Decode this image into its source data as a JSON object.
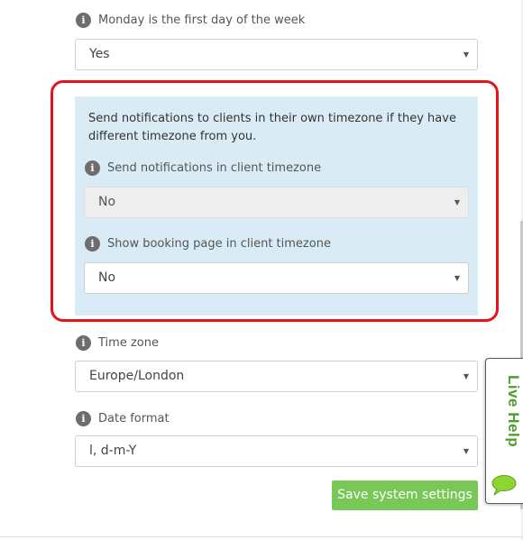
{
  "settings": {
    "monday_first": {
      "label": "Monday is the first day of the week",
      "value": "Yes"
    },
    "client_timezone_notice": "Send notifications to clients in their own timezone if they have different timezone from you.",
    "notifications_client_timezone": {
      "label": "Send notifications in client timezone",
      "value": "No",
      "disabled": true
    },
    "booking_page_client_timezone": {
      "label": "Show booking page in client timezone",
      "value": "No"
    },
    "time_zone": {
      "label": "Time zone",
      "value": "Europe/London"
    },
    "date_format": {
      "label": "Date format",
      "value": "l, d-m-Y"
    }
  },
  "actions": {
    "save_label": "Save system settings"
  },
  "live_help": {
    "label": "Live Help",
    "icon": "chat-bubble-icon"
  },
  "icons": {
    "info": "i",
    "caret": "▼"
  },
  "colors": {
    "highlight_border": "#e4141c",
    "panel_background": "#d9ecf5",
    "save_button": "#79c857",
    "live_help_text": "#4e9d2d"
  }
}
